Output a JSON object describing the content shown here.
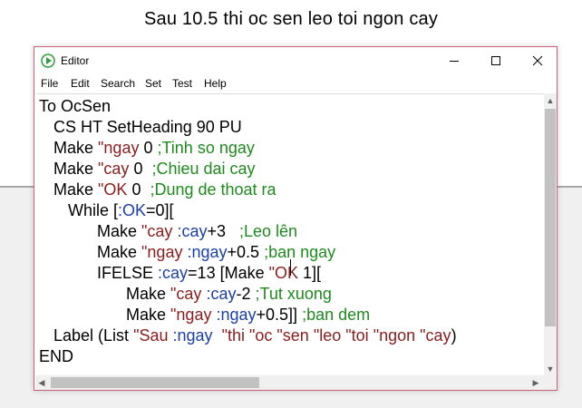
{
  "page": {
    "heading": "Sau 10.5 thi oc sen leo toi ngon cay"
  },
  "window": {
    "title": "Editor",
    "icon": "play-triangle-icon",
    "controls": {
      "minimize": "minimize-icon",
      "maximize": "maximize-icon",
      "close": "close-icon"
    }
  },
  "menu": {
    "items": [
      "File",
      "Edit",
      "Search",
      "Set",
      "Test",
      "Help"
    ]
  },
  "editor": {
    "lines": [
      {
        "indent": 0,
        "tokens": [
          {
            "t": "To OcSen",
            "c": "black"
          }
        ]
      },
      {
        "indent": 1,
        "tokens": [
          {
            "t": "CS HT SetHeading 90 PU",
            "c": "black"
          }
        ]
      },
      {
        "indent": 1,
        "tokens": [
          {
            "t": "Make ",
            "c": "black"
          },
          {
            "t": "\"ngay",
            "c": "red"
          },
          {
            "t": " 0 ",
            "c": "black"
          },
          {
            "t": ";Tinh so ngay",
            "c": "green"
          }
        ]
      },
      {
        "indent": 1,
        "tokens": [
          {
            "t": "Make ",
            "c": "black"
          },
          {
            "t": "\"cay",
            "c": "red"
          },
          {
            "t": " 0  ",
            "c": "black"
          },
          {
            "t": ";Chieu dai cay",
            "c": "green"
          }
        ]
      },
      {
        "indent": 1,
        "tokens": [
          {
            "t": "Make ",
            "c": "black"
          },
          {
            "t": "\"OK",
            "c": "red"
          },
          {
            "t": " 0  ",
            "c": "black"
          },
          {
            "t": ";Dung de thoat ra",
            "c": "green"
          }
        ]
      },
      {
        "indent": 2,
        "tokens": [
          {
            "t": "While [",
            "c": "black"
          },
          {
            "t": ":OK",
            "c": "blue"
          },
          {
            "t": "=0][",
            "c": "black"
          }
        ]
      },
      {
        "indent": 3,
        "tokens": [
          {
            "t": "Make ",
            "c": "black"
          },
          {
            "t": "\"cay",
            "c": "red"
          },
          {
            "t": " ",
            "c": "black"
          },
          {
            "t": ":cay",
            "c": "blue"
          },
          {
            "t": "+3   ",
            "c": "black"
          },
          {
            "t": ";Leo lên",
            "c": "green"
          }
        ]
      },
      {
        "indent": 3,
        "tokens": [
          {
            "t": "Make ",
            "c": "black"
          },
          {
            "t": "\"ngay",
            "c": "red"
          },
          {
            "t": " ",
            "c": "black"
          },
          {
            "t": ":ngay",
            "c": "blue"
          },
          {
            "t": "+0.5 ",
            "c": "black"
          },
          {
            "t": ";ban ngay",
            "c": "green"
          }
        ]
      },
      {
        "indent": 3,
        "tokens": [
          {
            "t": "IFELSE ",
            "c": "black"
          },
          {
            "t": ":cay",
            "c": "blue"
          },
          {
            "t": "=13 [Make ",
            "c": "black"
          },
          {
            "t": "\"OK",
            "c": "red"
          },
          {
            "t": " 1][",
            "c": "black"
          }
        ]
      },
      {
        "indent": 4,
        "tokens": [
          {
            "t": "Make ",
            "c": "black"
          },
          {
            "t": "\"cay",
            "c": "red"
          },
          {
            "t": " ",
            "c": "black"
          },
          {
            "t": ":cay",
            "c": "blue"
          },
          {
            "t": "-2 ",
            "c": "black"
          },
          {
            "t": ";Tut xuong",
            "c": "green"
          }
        ]
      },
      {
        "indent": 4,
        "tokens": [
          {
            "t": "Make ",
            "c": "black"
          },
          {
            "t": "\"ngay",
            "c": "red"
          },
          {
            "t": " ",
            "c": "black"
          },
          {
            "t": ":ngay",
            "c": "blue"
          },
          {
            "t": "+0.5]] ",
            "c": "black"
          },
          {
            "t": ";ban dem",
            "c": "green"
          }
        ]
      },
      {
        "indent": 1,
        "tokens": [
          {
            "t": "Label (List ",
            "c": "black"
          },
          {
            "t": "\"Sau",
            "c": "red"
          },
          {
            "t": " ",
            "c": "black"
          },
          {
            "t": ":ngay",
            "c": "blue"
          },
          {
            "t": "  ",
            "c": "black"
          },
          {
            "t": "\"thi",
            "c": "red"
          },
          {
            "t": " ",
            "c": "black"
          },
          {
            "t": "\"oc",
            "c": "red"
          },
          {
            "t": " ",
            "c": "black"
          },
          {
            "t": "\"sen",
            "c": "red"
          },
          {
            "t": " ",
            "c": "black"
          },
          {
            "t": "\"leo",
            "c": "red"
          },
          {
            "t": " ",
            "c": "black"
          },
          {
            "t": "\"toi",
            "c": "red"
          },
          {
            "t": " ",
            "c": "black"
          },
          {
            "t": "\"ngon",
            "c": "red"
          },
          {
            "t": " ",
            "c": "black"
          },
          {
            "t": "\"cay",
            "c": "red"
          },
          {
            "t": ")",
            "c": "black"
          }
        ]
      },
      {
        "indent": 0,
        "tokens": [
          {
            "t": "END",
            "c": "black"
          }
        ]
      }
    ]
  },
  "colors": {
    "keyword_text": "#000000",
    "word_literal": "#8b1c1c",
    "variable": "#1a3fa6",
    "comment": "#1e8a1e",
    "window_border": "#c8607a",
    "app_icon": "#2e9e3e"
  }
}
